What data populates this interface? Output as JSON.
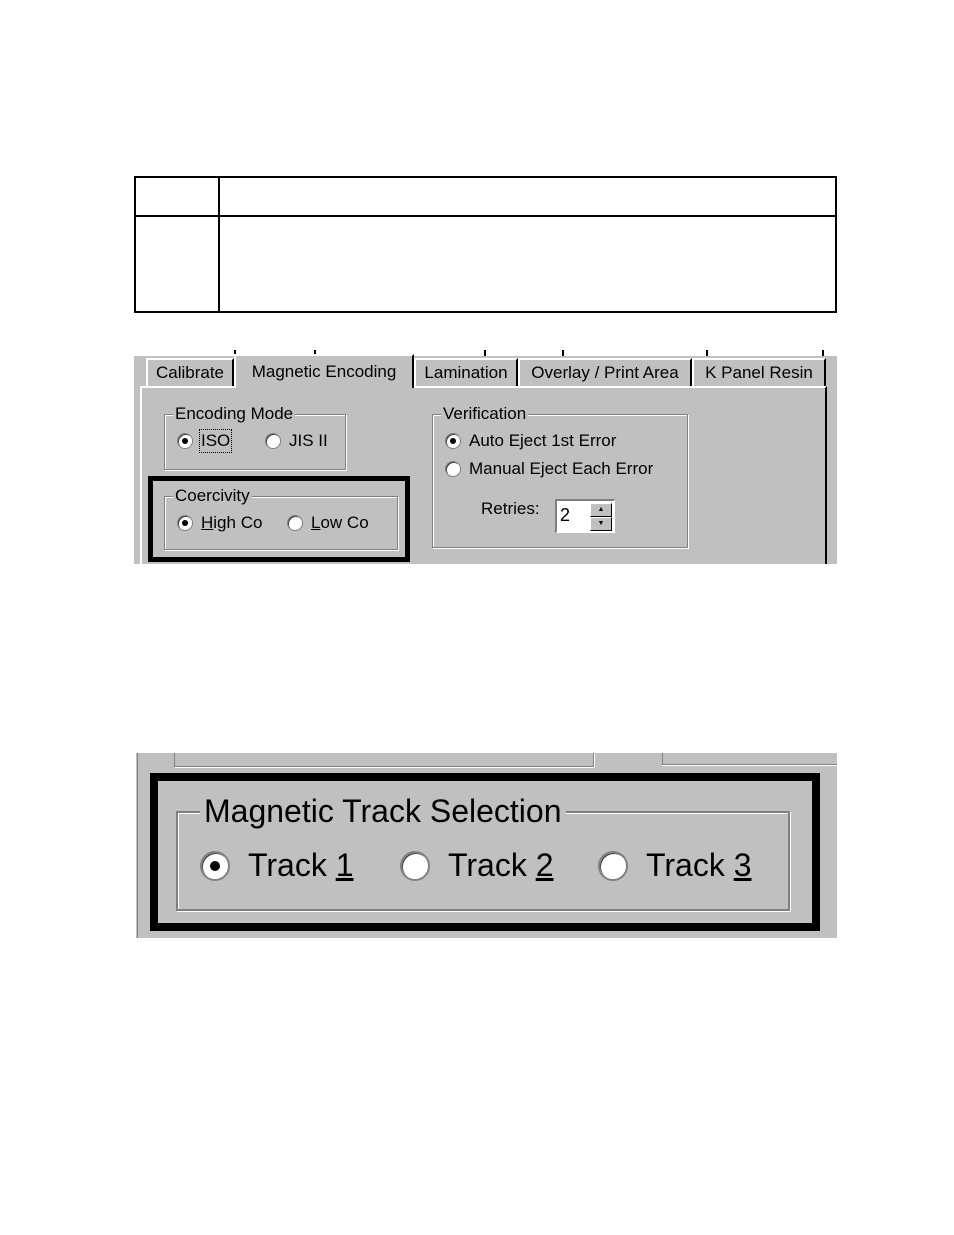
{
  "table": {
    "rows": [
      {
        "cells": [
          "",
          ""
        ]
      },
      {
        "cells": [
          "",
          ""
        ]
      }
    ]
  },
  "screenshot1": {
    "tabs": [
      {
        "label": "Calibrate",
        "active": false
      },
      {
        "label": "Magnetic Encoding",
        "active": true
      },
      {
        "label": "Lamination",
        "active": false
      },
      {
        "label": "Overlay / Print Area",
        "active": false
      },
      {
        "label": "K Panel Resin",
        "active": false
      }
    ],
    "encoding_mode": {
      "label": "Encoding Mode",
      "options": [
        {
          "label": "ISO",
          "selected": true
        },
        {
          "label": "JIS II",
          "selected": false
        }
      ]
    },
    "coercivity": {
      "label": "Coercivity",
      "options": [
        {
          "label_pre": "",
          "mnemonic": "H",
          "label_post": "igh Co",
          "selected": true
        },
        {
          "label_pre": "",
          "mnemonic": "L",
          "label_post": "ow Co",
          "selected": false
        }
      ]
    },
    "verification": {
      "label": "Verification",
      "options": [
        {
          "label": "Auto Eject 1st Error",
          "selected": true
        },
        {
          "label": "Manual Eject Each Error",
          "selected": false
        }
      ],
      "retries_label": "Retries:",
      "retries_value": "2",
      "spin_up": "▲",
      "spin_down": "▼"
    }
  },
  "screenshot2": {
    "group_label": "Magnetic Track Selection",
    "options": [
      {
        "label": "Track ",
        "mnemonic": "1",
        "selected": true
      },
      {
        "label": "Track ",
        "mnemonic": "2",
        "selected": false
      },
      {
        "label": "Track ",
        "mnemonic": "3",
        "selected": false
      }
    ]
  }
}
